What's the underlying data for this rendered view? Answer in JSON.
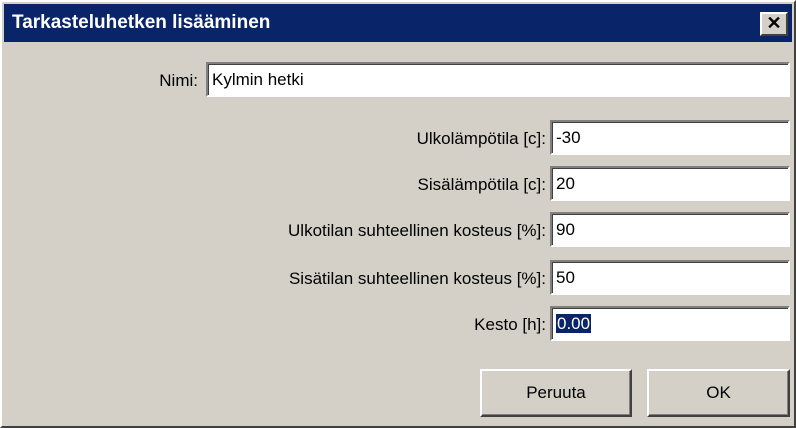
{
  "window": {
    "title": "Tarkasteluhetken lisääminen",
    "close_glyph": "✕"
  },
  "form": {
    "name": {
      "label": "Nimi:",
      "value": "Kylmin hetki"
    },
    "outdoor_temp": {
      "label": "Ulkolämpötila [c]:",
      "value": "-30"
    },
    "indoor_temp": {
      "label": "Sisälämpötila [c]:",
      "value": "20"
    },
    "outdoor_humidity": {
      "label": "Ulkotilan suhteellinen kosteus [%]:",
      "value": "90"
    },
    "indoor_humidity": {
      "label": "Sisätilan suhteellinen kosteus [%]:",
      "value": "50"
    },
    "duration": {
      "label": "Kesto [h]:",
      "value": "0.00"
    }
  },
  "buttons": {
    "cancel": "Peruuta",
    "ok": "OK"
  },
  "colors": {
    "titlebar": "#0a246a",
    "face": "#d4d0c8",
    "selection": "#0a246a"
  }
}
